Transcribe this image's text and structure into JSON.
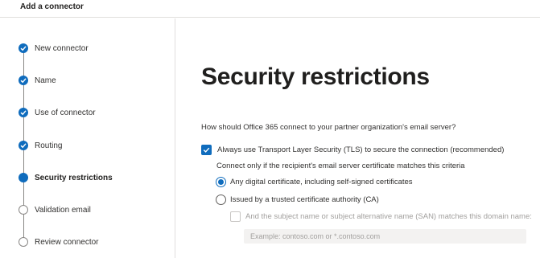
{
  "header": {
    "title": "Add a connector"
  },
  "steps": [
    {
      "label": "New connector",
      "state": "done"
    },
    {
      "label": "Name",
      "state": "done"
    },
    {
      "label": "Use of connector",
      "state": "done"
    },
    {
      "label": "Routing",
      "state": "done"
    },
    {
      "label": "Security restrictions",
      "state": "current"
    },
    {
      "label": "Validation email",
      "state": "todo"
    },
    {
      "label": "Review connector",
      "state": "todo"
    }
  ],
  "main": {
    "title": "Security restrictions",
    "question": "How should Office 365 connect to your partner organization's email server?",
    "tls_checkbox": {
      "label": "Always use Transport Layer Security (TLS) to secure the connection (recommended)",
      "checked": true
    },
    "criteria_text": "Connect only if the recipient's email server certificate matches this criteria",
    "radios": [
      {
        "label": "Any digital certificate, including self-signed certificates",
        "selected": true
      },
      {
        "label": "Issued by a trusted certificate authority (CA)",
        "selected": false
      }
    ],
    "san_checkbox": {
      "label": "And the subject name or subject alternative name (SAN) matches this domain name:",
      "checked": false,
      "disabled": true
    },
    "domain_input": {
      "value": "",
      "placeholder": "Example: contoso.com or *.contoso.com"
    }
  },
  "colors": {
    "accent": "#0f6cbd",
    "divider": "#e1dfdd",
    "disabled_text": "#a19f9d",
    "input_bg": "#f3f2f1"
  }
}
